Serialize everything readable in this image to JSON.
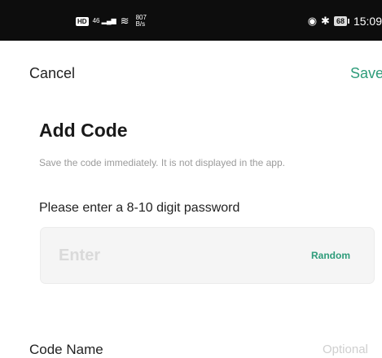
{
  "status_bar": {
    "hd_badge": "HD",
    "signal_icon": "46 ▂▄▆",
    "wifi_icon": "≋",
    "net_speed_value": "807",
    "net_speed_unit": "B/s",
    "eye_icon": "◉",
    "bluetooth_icon": "✱",
    "battery_level": "68",
    "time": "15:09"
  },
  "header": {
    "cancel_label": "Cancel",
    "save_label": "Save"
  },
  "form": {
    "title": "Add Code",
    "subtitle": "Save the code immediately. It is not displayed in the app.",
    "password_label": "Please enter a 8-10 digit password",
    "code_input": {
      "value": "",
      "placeholder": "Enter"
    },
    "random_label": "Random",
    "code_name_label": "Code Name",
    "code_name_placeholder": "Optional"
  },
  "colors": {
    "accent": "#2e9c7a",
    "status_bar_bg": "#0d0d0d",
    "input_bg": "#f5f5f5"
  }
}
